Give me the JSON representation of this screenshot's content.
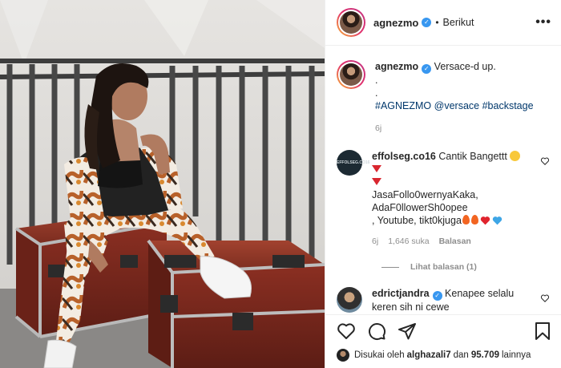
{
  "header": {
    "username": "agnezmo",
    "separator": "•",
    "follow_label": "Berikut",
    "more_label": "•••"
  },
  "caption": {
    "username": "agnezmo",
    "text": "Versace-d up.",
    "dot1": ".",
    "dot2": ".",
    "hashtag1": "#AGNEZMO",
    "mention": "@versace",
    "hashtag2": "#backstage",
    "time": "6j"
  },
  "comments": [
    {
      "username": "effolseg.co16",
      "avatar_text": "EFFOLSEG.CO16",
      "line1": "Cantik Bangettt",
      "line3": "JasaFollo0wernyaKaka,",
      "line4": "AdaF0llowerSh0opee",
      "line5": ", Youtube, tikt0kjuga",
      "time": "6j",
      "likes": "1,646 suka",
      "reply": "Balasan",
      "view_replies": "Lihat balasan (1)"
    },
    {
      "username": "edrictjandra",
      "line1": "Kenapee selalu",
      "line2": "keren sih ni cewe"
    }
  ],
  "likes_bar": {
    "prefix": "Disukai oleh",
    "user": "alghazali7",
    "and": "dan",
    "count": "95.709",
    "suffix": "lainnya"
  },
  "icons": {
    "like": "heart-icon",
    "comment": "comment-icon",
    "share": "share-icon",
    "save": "bookmark-icon",
    "verified": "verified-badge-icon"
  },
  "colors": {
    "verified_blue": "#3897f0",
    "link_blue": "#00376b",
    "muted": "#8e8e8e",
    "heart_red": "#ed4956"
  }
}
